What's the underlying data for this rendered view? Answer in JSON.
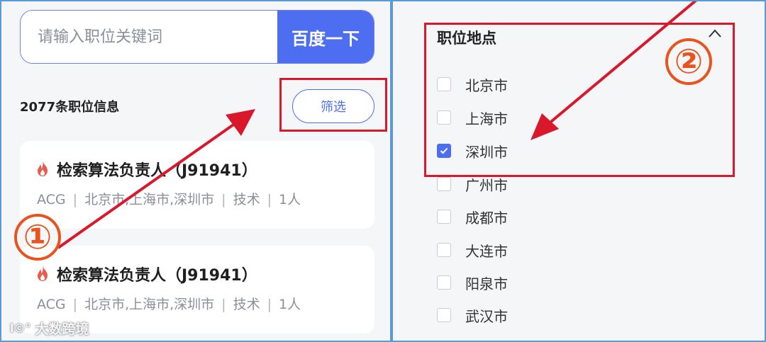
{
  "search": {
    "placeholder": "请输入职位关键词",
    "button_label": "百度一下"
  },
  "results": {
    "count_text": "2077条职位信息",
    "filter_label": "筛选"
  },
  "jobs": [
    {
      "title": "检索算法负责人（J91941）",
      "meta": [
        "ACG",
        "北京市,上海市,深圳市",
        "技术",
        "1人"
      ]
    },
    {
      "title": "检索算法负责人（J91941）",
      "meta": [
        "ACG",
        "北京市,上海市,深圳市",
        "技术",
        "1人"
      ]
    }
  ],
  "filter_panel": {
    "section_title": "职位地点",
    "options": [
      {
        "label": "北京市",
        "checked": false
      },
      {
        "label": "上海市",
        "checked": false
      },
      {
        "label": "深圳市",
        "checked": true
      },
      {
        "label": "广州市",
        "checked": false
      },
      {
        "label": "成都市",
        "checked": false
      },
      {
        "label": "大连市",
        "checked": false
      },
      {
        "label": "阳泉市",
        "checked": false
      },
      {
        "label": "武汉市",
        "checked": false
      }
    ]
  },
  "annotations": {
    "step1": "①",
    "step2": "②"
  },
  "watermark": {
    "text": "大数跨境",
    "logo": "l©°"
  },
  "colors": {
    "accent": "#4e6ef2",
    "annotation_red": "#d9182b",
    "circle_orange": "#e8541f",
    "fire": "#e85b4b"
  },
  "icons": {
    "hot": "fire-icon",
    "collapse": "chevron-up-icon",
    "check": "check-icon"
  }
}
